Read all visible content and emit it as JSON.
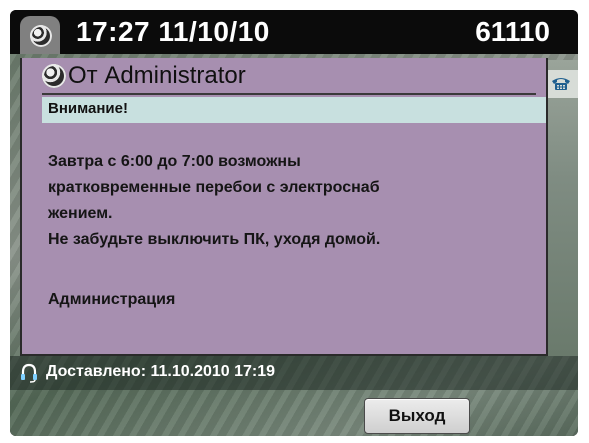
{
  "header": {
    "datetime": "17:27 11/10/10",
    "extension": "61110"
  },
  "message": {
    "title": "От Administrator",
    "subject": "Внимание!",
    "lines": [
      "Завтра с 6:00 до 7:00 возможны",
      "кратковременные перебои с электроснаб",
      "жением.",
      "Не забудьте выключить ПК, уходя домой.",
      "",
      "Администрация"
    ]
  },
  "status": {
    "delivered": "Доставлено: 11.10.2010 17:19"
  },
  "softkeys": {
    "exit_label": "Выход"
  },
  "icons": {
    "header": "globe-icon",
    "message": "globe-icon",
    "line": "phone-icon",
    "status": "headset-icon"
  },
  "colors": {
    "panel": "#a78fb0",
    "subject_bar": "#c8e0df",
    "header_bg": "#0b0b0b"
  }
}
